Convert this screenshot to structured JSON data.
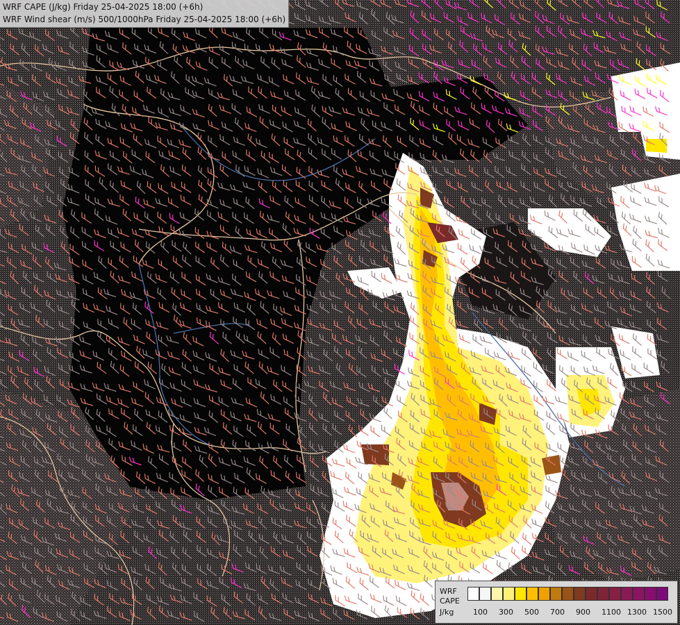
{
  "title": {
    "line1": "WRF CAPE (J/kg) Friday 25-04-2025 18:00 (+6h)",
    "line2": "WRF Wind shear (m/s) 500/1000hPa Friday 25-04-2025 18:00 (+6h)"
  },
  "legend": {
    "labels": [
      "WRF",
      "CAPE",
      "J/kg"
    ],
    "colors": [
      "#ffffff",
      "#f6f6f6",
      "#fff6b0",
      "#fff07a",
      "#ffe600",
      "#ffbf00",
      "#f0a000",
      "#c07a10",
      "#9a5418",
      "#7f3a20",
      "#7a2a2a",
      "#7f2338",
      "#862045",
      "#8a1a55",
      "#8c1462",
      "#8a0d70",
      "#7d0a78"
    ],
    "ticks": [
      "100",
      "300",
      "500",
      "700",
      "900",
      "1100",
      "1300",
      "1500"
    ]
  },
  "colors": {
    "background": "#000000",
    "barb_weak": "#9a8a8a",
    "barb_mid": "#e07a6a",
    "barb_strong": "#ff33cc",
    "barb_yellow": "#ffff22",
    "border": "#e8c8a0",
    "river": "#4a6fa8"
  }
}
